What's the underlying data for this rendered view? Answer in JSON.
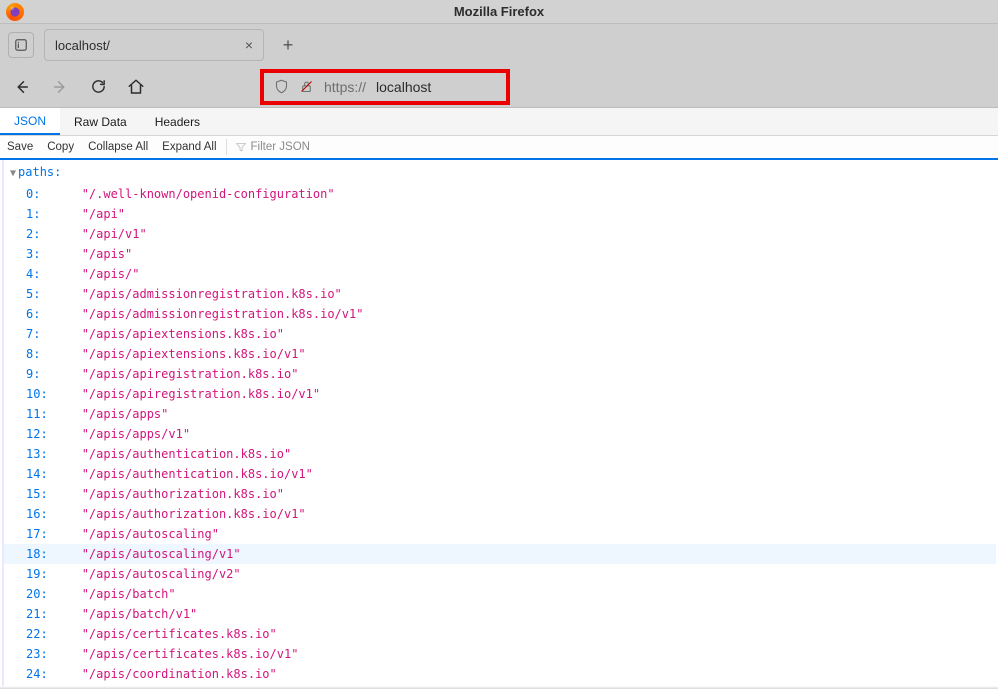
{
  "window": {
    "title": "Mozilla Firefox"
  },
  "tab": {
    "title": "localhost/"
  },
  "url": {
    "scheme": "https://",
    "host": "localhost"
  },
  "devtabs": {
    "json": "JSON",
    "raw": "Raw Data",
    "headers": "Headers"
  },
  "toolbar": {
    "save": "Save",
    "copy": "Copy",
    "collapse": "Collapse All",
    "expand": "Expand All",
    "filter_placeholder": "Filter JSON"
  },
  "json": {
    "root_key": "paths:",
    "items": [
      "/.well-known/openid-configuration",
      "/api",
      "/api/v1",
      "/apis",
      "/apis/",
      "/apis/admissionregistration.k8s.io",
      "/apis/admissionregistration.k8s.io/v1",
      "/apis/apiextensions.k8s.io",
      "/apis/apiextensions.k8s.io/v1",
      "/apis/apiregistration.k8s.io",
      "/apis/apiregistration.k8s.io/v1",
      "/apis/apps",
      "/apis/apps/v1",
      "/apis/authentication.k8s.io",
      "/apis/authentication.k8s.io/v1",
      "/apis/authorization.k8s.io",
      "/apis/authorization.k8s.io/v1",
      "/apis/autoscaling",
      "/apis/autoscaling/v1",
      "/apis/autoscaling/v2",
      "/apis/batch",
      "/apis/batch/v1",
      "/apis/certificates.k8s.io",
      "/apis/certificates.k8s.io/v1",
      "/apis/coordination.k8s.io"
    ],
    "hover_index": 18
  }
}
